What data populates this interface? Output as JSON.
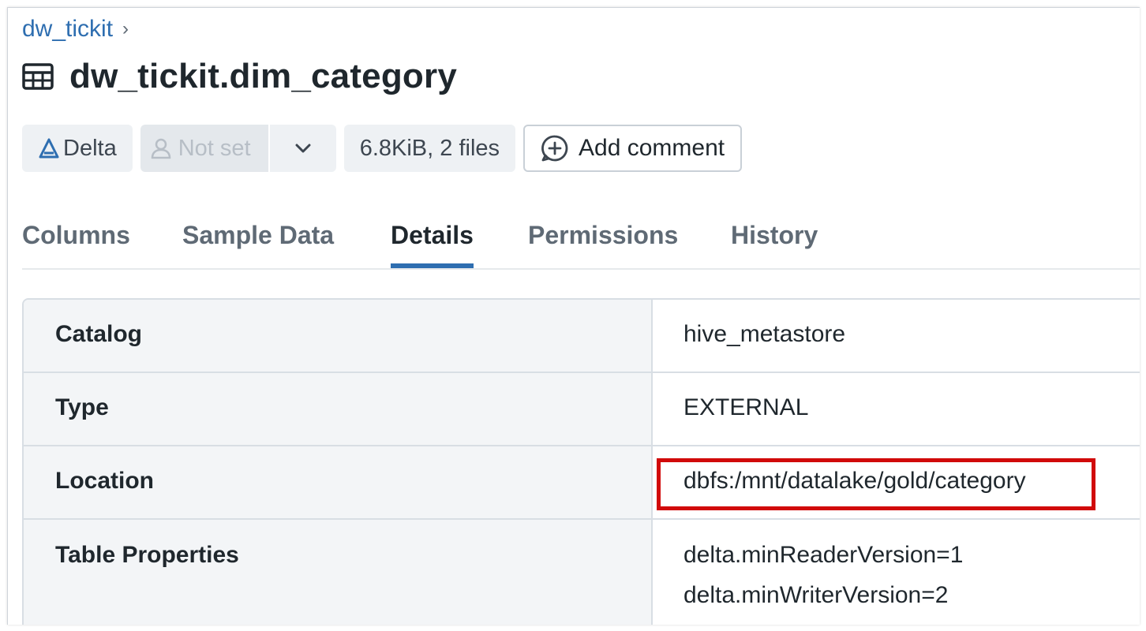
{
  "breadcrumb": {
    "parent": "dw_tickit",
    "separator": "›"
  },
  "page": {
    "title": "dw_tickit.dim_category",
    "icon": "table-icon"
  },
  "badges": {
    "format": {
      "label": "Delta",
      "icon": "delta-icon"
    },
    "owner": {
      "label": "Not set",
      "icon": "person-icon",
      "dropdown_icon": "chevron-down-icon"
    },
    "size": {
      "label": "6.8KiB, 2 files"
    },
    "comment": {
      "label": "Add comment",
      "icon": "add-comment-icon"
    }
  },
  "tabs": [
    {
      "label": "Columns",
      "active": false
    },
    {
      "label": "Sample Data",
      "active": false
    },
    {
      "label": "Details",
      "active": true
    },
    {
      "label": "Permissions",
      "active": false
    },
    {
      "label": "History",
      "active": false
    }
  ],
  "details": [
    {
      "key": "Catalog",
      "value": "hive_metastore"
    },
    {
      "key": "Type",
      "value": "EXTERNAL"
    },
    {
      "key": "Location",
      "value": "dbfs:/mnt/datalake/gold/category",
      "highlighted": true
    },
    {
      "key": "Table Properties",
      "values": [
        "delta.minReaderVersion=1",
        "delta.minWriterVersion=2"
      ]
    }
  ],
  "colors": {
    "accent": "#2e6eb0",
    "highlight_border": "#d10a0a",
    "key_background": "#f3f5f7",
    "text": "#1f272d"
  }
}
